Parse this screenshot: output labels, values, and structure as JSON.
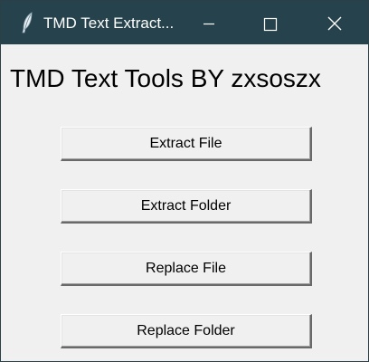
{
  "window": {
    "title": "TMD Text Extract..."
  },
  "main": {
    "heading": "TMD Text Tools BY zxsoszx",
    "buttons": [
      {
        "label": "Extract File"
      },
      {
        "label": "Extract Folder"
      },
      {
        "label": "Replace File"
      },
      {
        "label": "Replace Folder"
      }
    ]
  },
  "colors": {
    "titlebar": "#26434d",
    "client_background": "#f0f0f0",
    "button_face": "#f0f0f0"
  },
  "icons": {
    "app": "feather-icon",
    "minimize": "minimize-icon",
    "maximize": "maximize-icon",
    "close": "close-icon"
  }
}
